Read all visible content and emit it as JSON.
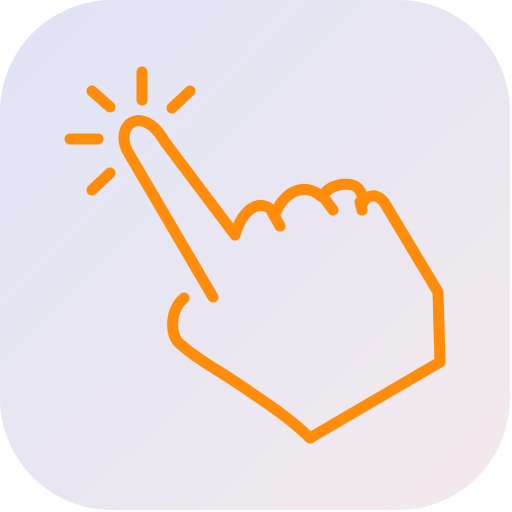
{
  "icon": {
    "name": "tap-gesture-icon",
    "accent_color": "#ff8c0a",
    "background_colors": [
      "#e1e4f6",
      "#f4e9ec"
    ]
  }
}
